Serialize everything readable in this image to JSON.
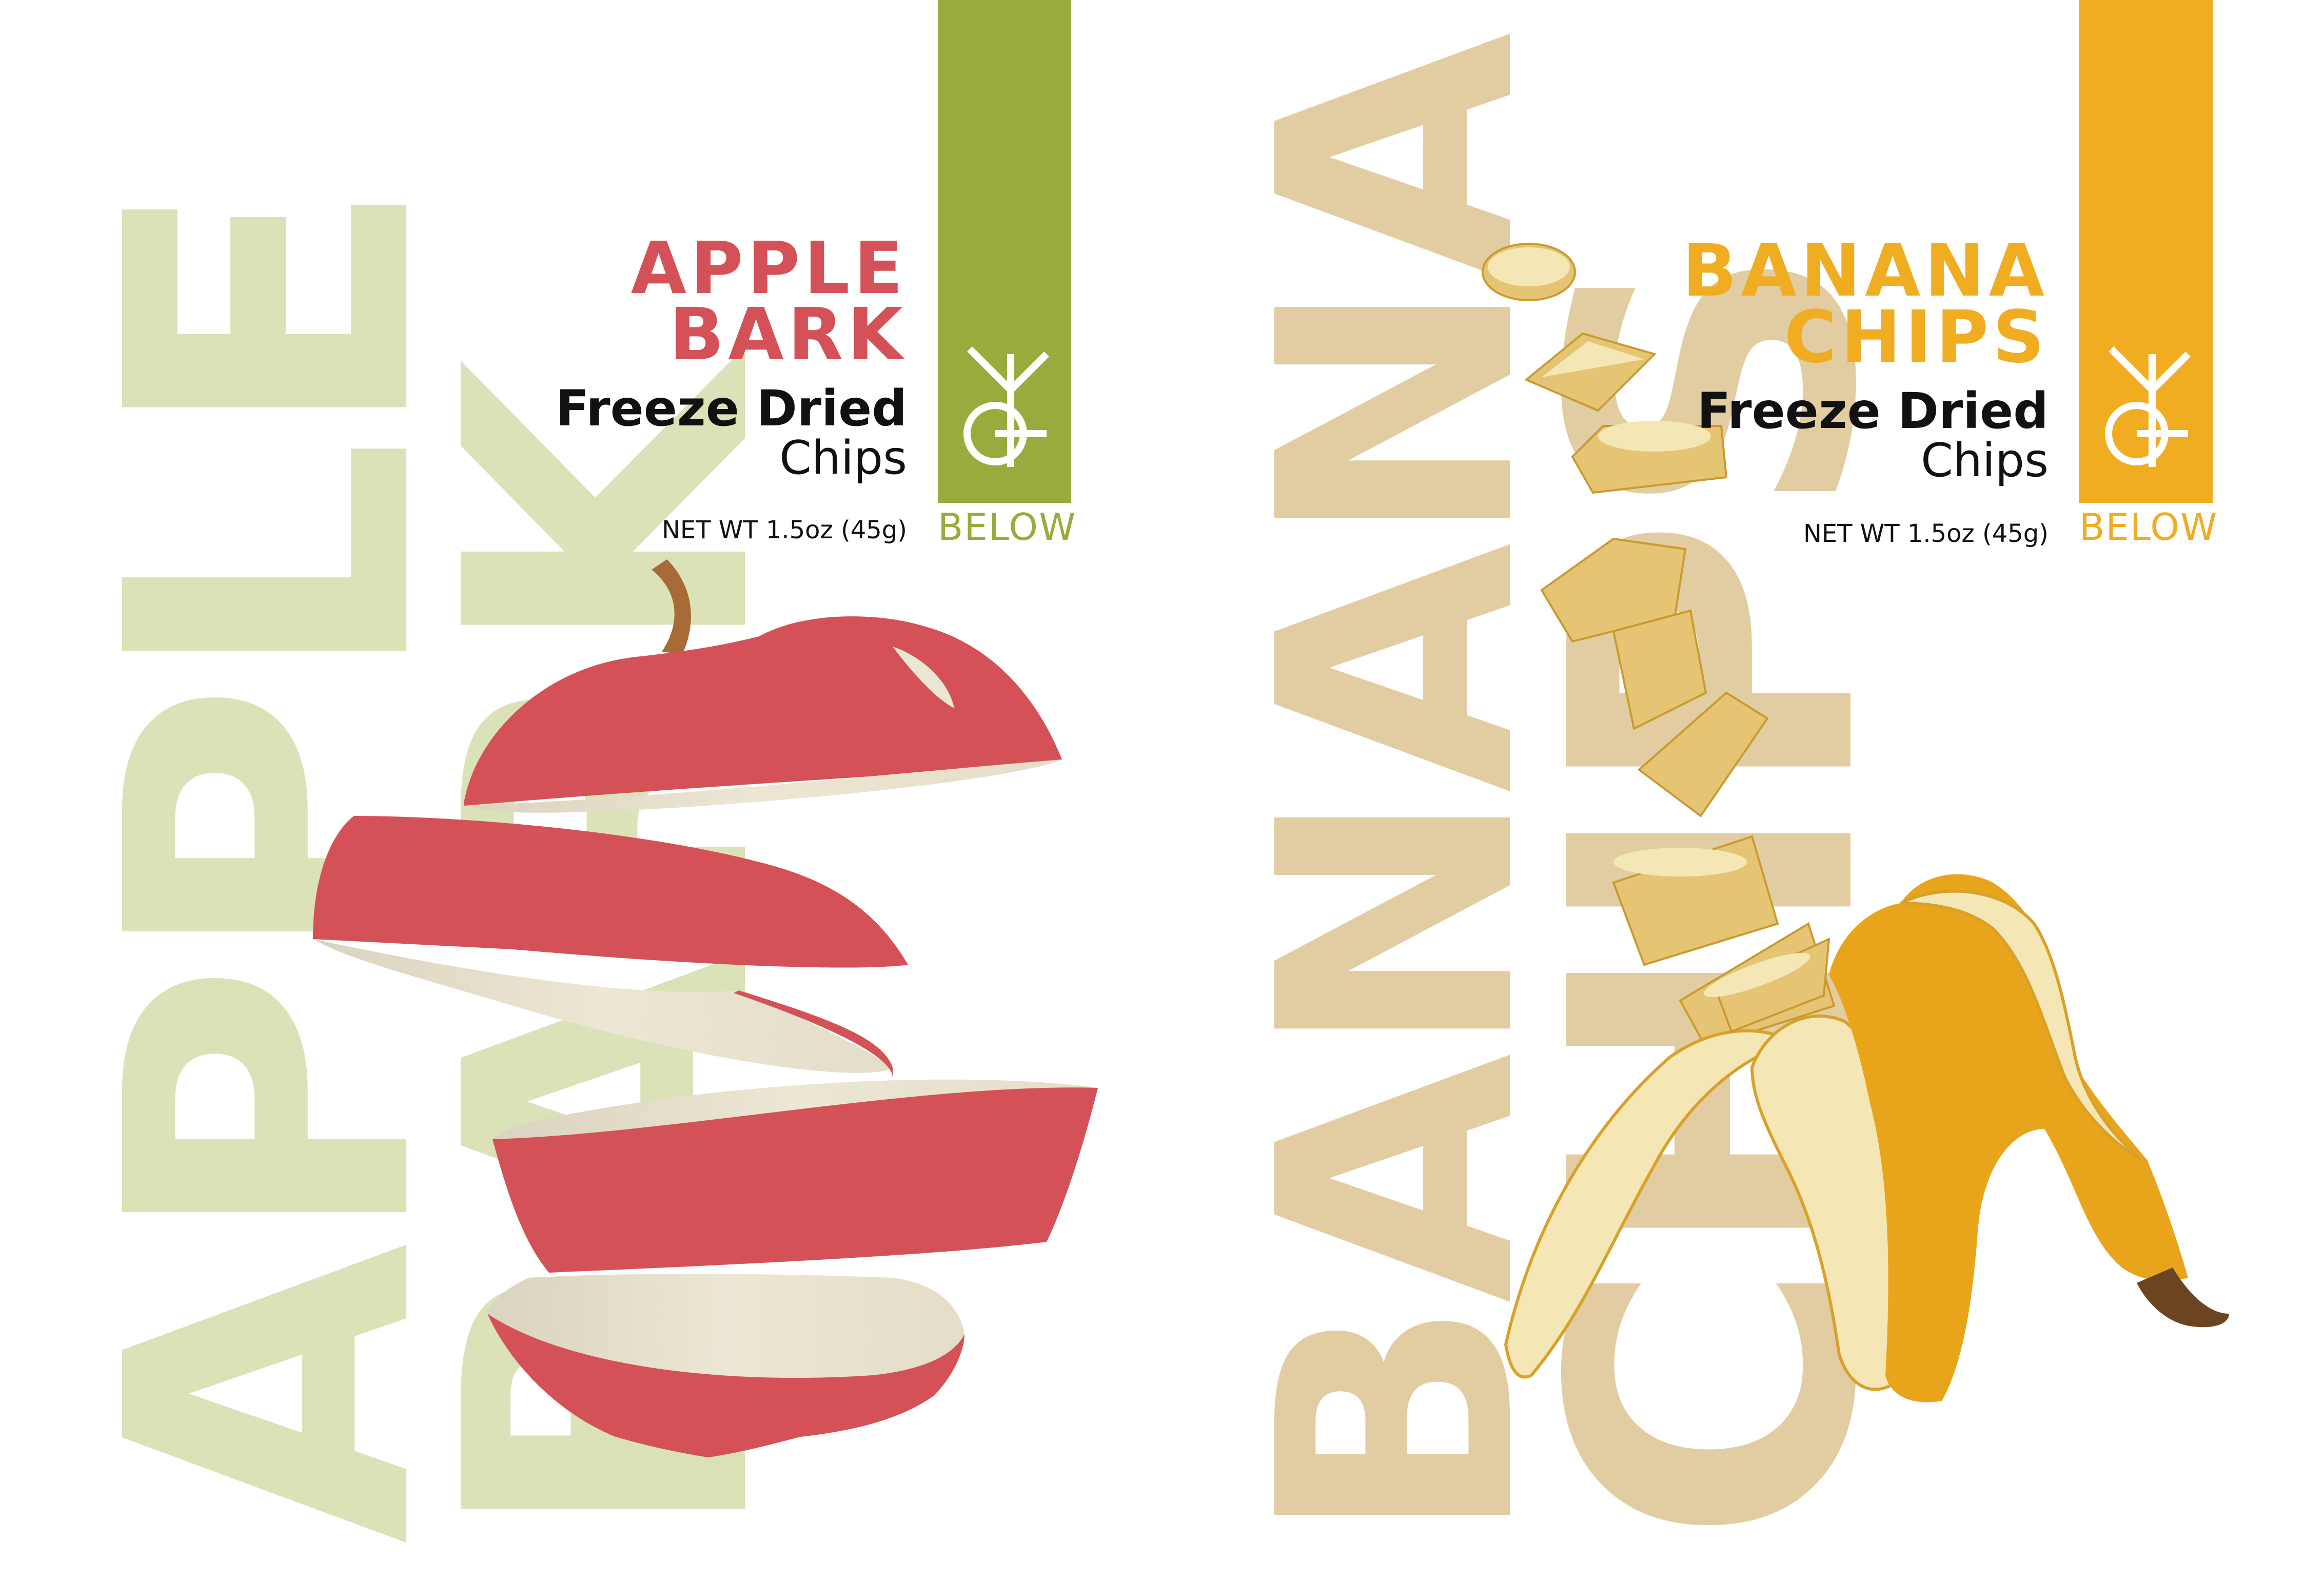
{
  "apple": {
    "bg_word_1": "APPLE",
    "bg_word_2": "BARK",
    "title_line_1": "APPLE",
    "title_line_2": "BARK",
    "subtitle_1": "Freeze Dried",
    "subtitle_2": "Chips",
    "net_weight": "NET WT 1.5oz (45g)",
    "brand": "BELOW",
    "colors": {
      "accent": "#d45157",
      "bar": "#97ac3c",
      "bg_text": "#dbe2b8"
    }
  },
  "banana": {
    "bg_word_1": "BANANA",
    "bg_word_2": "CHIPS",
    "title_line_1": "BANANA",
    "title_line_2": "CHIPS",
    "subtitle_1": "Freeze Dried",
    "subtitle_2": "Chips",
    "net_weight": "NET WT 1.5oz (45g)",
    "brand": "BELOW",
    "colors": {
      "accent": "#f0ad22",
      "bar": "#f0ad22",
      "bg_text": "#e1cda1"
    }
  }
}
